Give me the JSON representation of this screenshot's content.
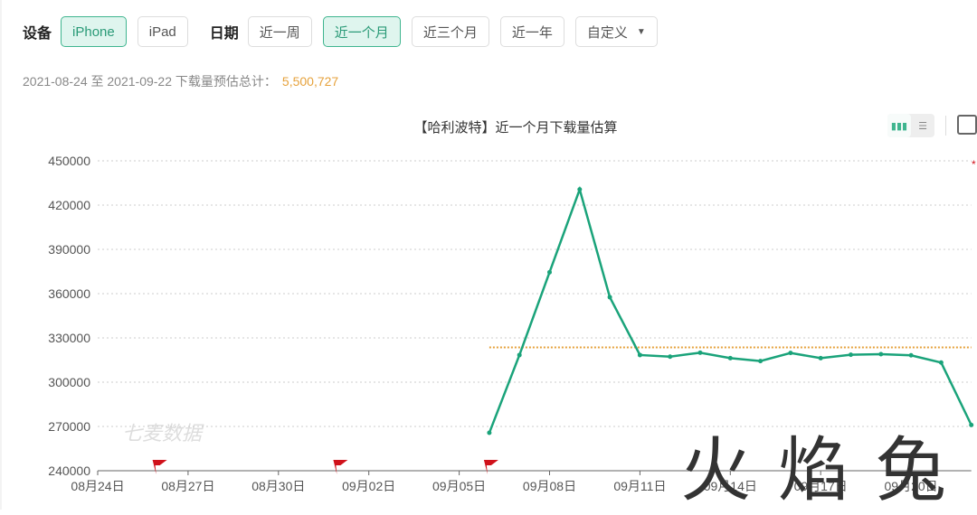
{
  "filters": {
    "device_label": "设备",
    "devices": [
      {
        "label": "iPhone",
        "active": true
      },
      {
        "label": "iPad",
        "active": false
      }
    ],
    "date_label": "日期",
    "ranges": [
      {
        "label": "近一周",
        "active": false
      },
      {
        "label": "近一个月",
        "active": true
      },
      {
        "label": "近三个月",
        "active": false
      },
      {
        "label": "近一年",
        "active": false
      }
    ],
    "custom_label": "自定义"
  },
  "summary": {
    "text": "2021-08-24 至 2021-09-22 下载量预估总计：",
    "total": "5,500,727"
  },
  "toolbar": {
    "icons": [
      "bar-chart-icon",
      "list-icon",
      "image-download-icon"
    ]
  },
  "watermarks": {
    "brand": "七麦数据",
    "overlay": "火焰兔"
  },
  "colors": {
    "accent": "#3fb58f",
    "line": "#1aa37a",
    "average": "#e6a23c",
    "flag": "#d0121b"
  },
  "chart_data": {
    "type": "line",
    "title": "【哈利波特】近一个月下载量估算",
    "ylim": [
      240000,
      450000
    ],
    "yticks": [
      240000,
      270000,
      300000,
      330000,
      360000,
      390000,
      420000,
      450000
    ],
    "xticks": [
      "08月24日",
      "08月27日",
      "08月30日",
      "09月02日",
      "09月05日",
      "09月08日",
      "09月11日",
      "09月14日",
      "09月17日",
      "09月20日"
    ],
    "x_start": "08-24",
    "x_end": "09-22",
    "grid": true,
    "series": [
      {
        "x": [
          "09-06",
          "09-07",
          "09-08",
          "09-09",
          "09-10",
          "09-11",
          "09-12",
          "09-13",
          "09-14",
          "09-15",
          "09-16",
          "09-17",
          "09-18",
          "09-19",
          "09-20",
          "09-21",
          "09-22"
        ],
        "values": [
          265700,
          318400,
          374500,
          430600,
          357600,
          318400,
          317300,
          320000,
          316300,
          314300,
          319800,
          316300,
          318600,
          319000,
          318200,
          313300,
          271000
        ]
      }
    ],
    "average": 323572,
    "flags": [
      "08-26",
      "09-01",
      "09-06"
    ]
  }
}
